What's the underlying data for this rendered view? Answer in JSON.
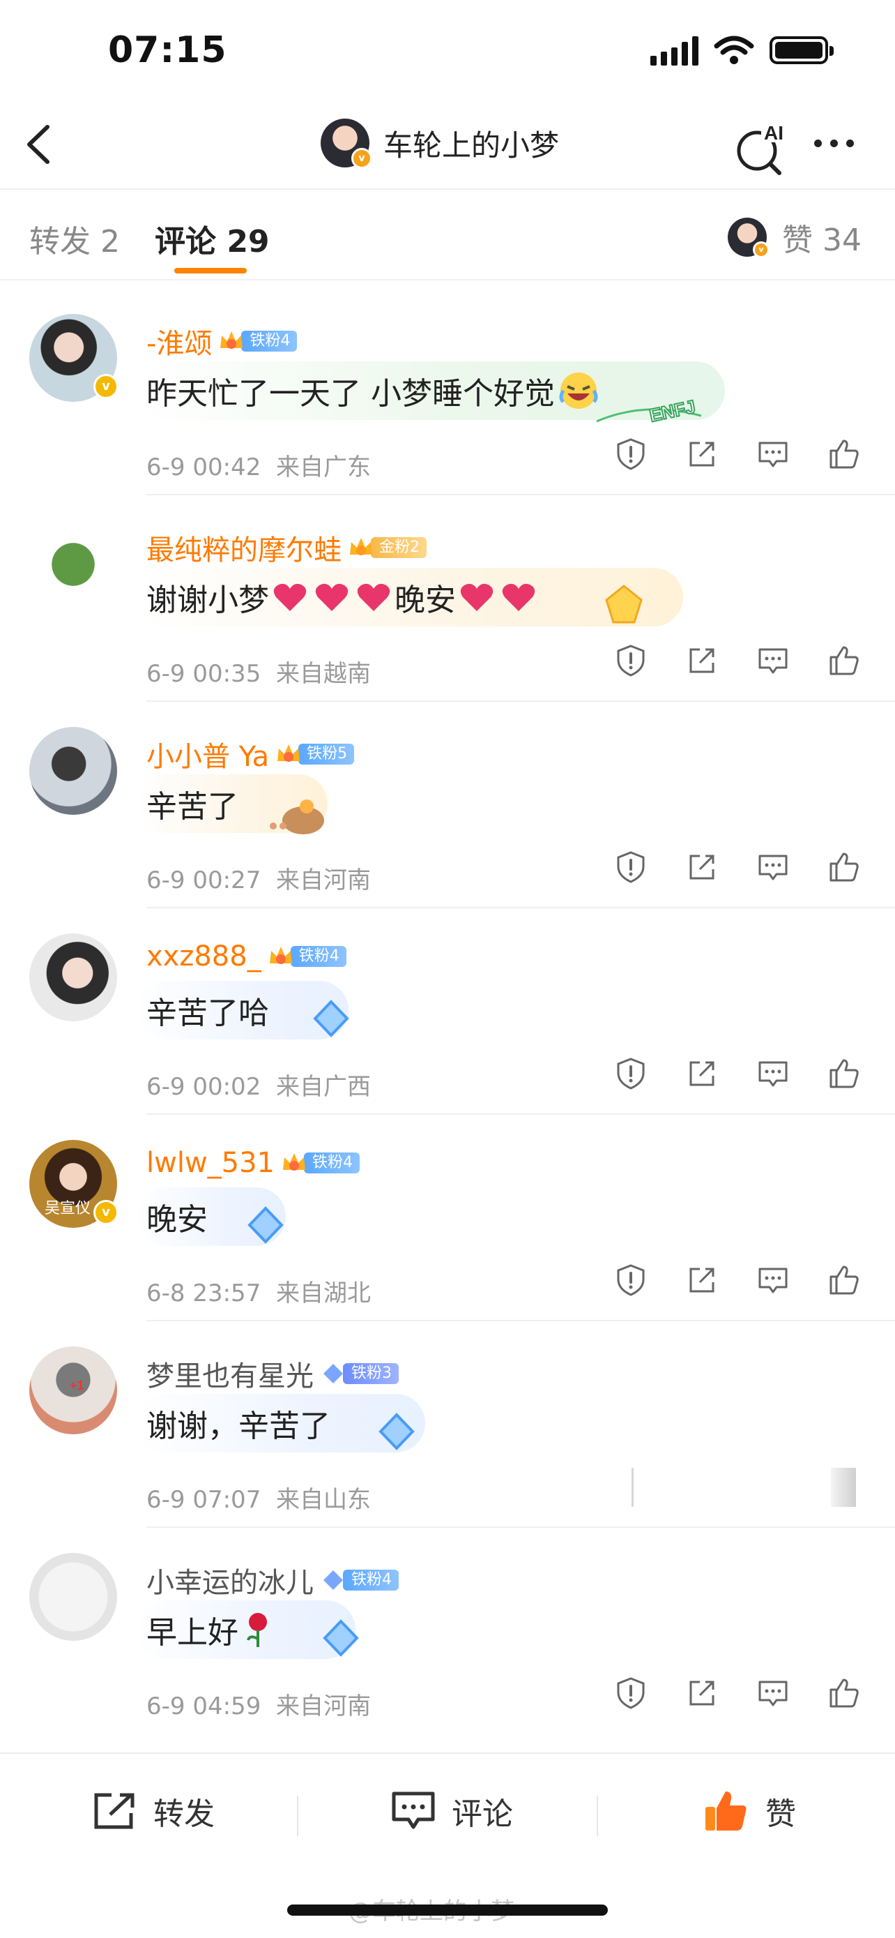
{
  "status_bar": {
    "time": "07:15"
  },
  "nav": {
    "title": "车轮上的小梦",
    "ai_label": "AI"
  },
  "tabs": {
    "repost": "转发 2",
    "comments": "评论 29",
    "likes_label": "赞 34"
  },
  "comments": [
    {
      "name": "-淮颂",
      "fan_badge": "铁粉4",
      "text": "昨天忙了一天了 小梦睡个好觉",
      "time": "6-9 00:42",
      "location": "来自广东",
      "bubble_tag": "ENFJ",
      "name_color": "#ff7a00",
      "avatar_verified": true
    },
    {
      "name": "最纯粹的摩尔蛙",
      "fan_badge": "金粉2",
      "text_before": "谢谢小梦",
      "text_after": "晚安",
      "time": "6-9 00:35",
      "location": "来自越南",
      "name_color": "#ff7a00"
    },
    {
      "name": "小小普 Ya",
      "fan_badge": "铁粉5",
      "text": "辛苦了",
      "time": "6-9 00:27",
      "location": "来自河南",
      "name_color": "#ff7a00"
    },
    {
      "name": "xxz888_",
      "fan_badge": "铁粉4",
      "text": "辛苦了哈",
      "time": "6-9 00:02",
      "location": "来自广西",
      "name_color": "#ff7a00"
    },
    {
      "name": "lwlw_531",
      "fan_badge": "铁粉4",
      "text": "晚安",
      "time": "6-8 23:57",
      "location": "来自湖北",
      "name_color": "#ff7a00",
      "avatar_verified": true,
      "avatar_text": "吴宣仪"
    },
    {
      "name": "梦里也有星光",
      "fan_badge": "铁粉3",
      "text": "谢谢，辛苦了",
      "time": "6-9 07:07",
      "location": "来自山东",
      "name_color": "#555555",
      "avatar_text": "+1"
    },
    {
      "name": "小幸运的冰儿",
      "fan_badge": "铁粉4",
      "text": "早上好",
      "time": "6-9 04:59",
      "location": "来自河南",
      "name_color": "#555555"
    }
  ],
  "bottom_bar": {
    "repost": "转发",
    "comment": "评论",
    "like": "赞"
  },
  "watermark": "@车轮上的小梦",
  "colors": {
    "accent": "#ff8200",
    "name_orange": "#ff7a00",
    "meta_gray": "#9a9a9a"
  }
}
